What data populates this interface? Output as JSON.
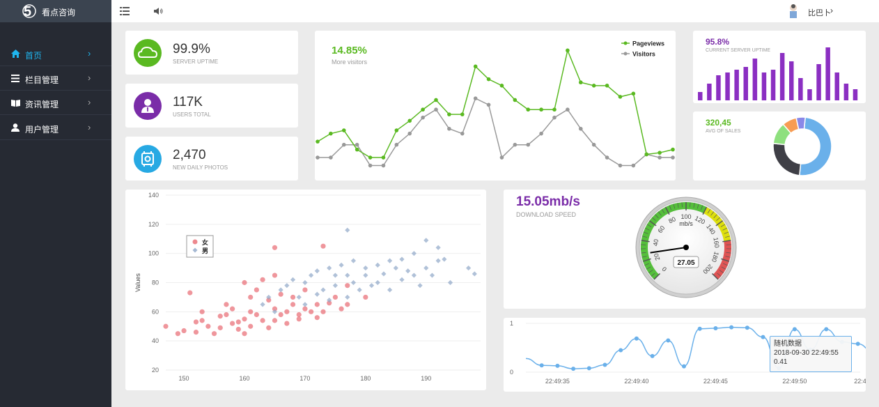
{
  "header": {
    "brand": "看点咨询",
    "user": "比巴卜"
  },
  "colors": {
    "sidebar": "#262a33",
    "accent": "#1fb5ee",
    "green": "#5ab921",
    "purple": "#7a2ca8"
  },
  "sidebar": {
    "items": [
      {
        "label": "首页",
        "icon": "home-icon"
      },
      {
        "label": "栏目管理",
        "icon": "list-icon"
      },
      {
        "label": "资讯管理",
        "icon": "book-icon"
      },
      {
        "label": "用户管理",
        "icon": "user-icon"
      }
    ]
  },
  "stats": [
    {
      "value": "99.9%",
      "label": "SERVER UPTIME",
      "icon": "cloud-icon",
      "color": "#5ab921"
    },
    {
      "value": "117K",
      "label": "USERS TOTAL",
      "icon": "user-suit-icon",
      "color": "#7a2ca8"
    },
    {
      "value": "2,470",
      "label": "NEW DAILY PHOTOS",
      "icon": "camera-icon",
      "color": "#27a9e3"
    }
  ],
  "traffic": {
    "value": "14.85%",
    "label": "More visitors"
  },
  "server": {
    "value": "95.8%",
    "label": "CURRENT SERVER UPTIME"
  },
  "sales": {
    "value": "320,45",
    "label": "AVG OF SALES"
  },
  "download": {
    "value": "15.05mb/s",
    "label": "DOWNLOAD SPEED"
  },
  "tooltip": {
    "title": "随机数据",
    "time": "2018-09-30 22:49:55",
    "value": "0.41"
  },
  "chart_data": [
    {
      "type": "line",
      "series": [
        {
          "name": "Pageviews",
          "color": "#5ab921",
          "values": [
            5,
            10,
            12,
            0,
            -5,
            -5,
            12,
            18,
            25,
            31,
            22,
            22,
            52,
            44,
            40,
            31,
            25,
            25,
            25,
            62,
            42,
            40,
            40,
            33,
            35,
            -3,
            -2,
            0
          ]
        },
        {
          "name": "Visitors",
          "color": "#999999",
          "values": [
            -5,
            -5,
            3,
            3,
            -10,
            -10,
            3,
            10,
            20,
            25,
            13,
            10,
            32,
            28,
            -5,
            3,
            3,
            10,
            20,
            25,
            13,
            3,
            -5,
            -10,
            -10,
            -3,
            -5,
            -5
          ]
        }
      ],
      "ylim": [
        -15,
        70
      ],
      "legend": "top-right"
    },
    {
      "type": "bar",
      "values": [
        3,
        6,
        9,
        10,
        11,
        12,
        15,
        10,
        11,
        17,
        14,
        8,
        4,
        13,
        19,
        10,
        6,
        4
      ],
      "ylim": [
        0,
        20
      ],
      "color": "#8b2fc2"
    },
    {
      "type": "pie",
      "values": [
        50,
        25,
        12,
        8,
        5
      ],
      "colors": [
        "#6ab0ea",
        "#3f3f46",
        "#8ee07e",
        "#f79c54",
        "#8a88e8"
      ]
    },
    {
      "type": "scatter",
      "series": [
        {
          "name": "女",
          "color": "#e86a72",
          "points": [
            [
              147,
              50
            ],
            [
              149,
              45
            ],
            [
              150,
              47
            ],
            [
              151,
              73
            ],
            [
              152,
              53
            ],
            [
              152,
              46
            ],
            [
              153,
              60
            ],
            [
              153,
              54
            ],
            [
              154,
              50
            ],
            [
              155,
              45
            ],
            [
              156,
              57
            ],
            [
              156,
              49
            ],
            [
              157,
              58
            ],
            [
              157,
              65
            ],
            [
              158,
              62
            ],
            [
              158,
              52
            ],
            [
              159,
              53
            ],
            [
              159,
              48
            ],
            [
              160,
              55
            ],
            [
              160,
              80
            ],
            [
              160,
              45
            ],
            [
              161,
              70
            ],
            [
              161,
              60
            ],
            [
              161,
              50
            ],
            [
              162,
              75
            ],
            [
              162,
              58
            ],
            [
              163,
              82
            ],
            [
              163,
              54
            ],
            [
              164,
              68
            ],
            [
              164,
              49
            ],
            [
              165,
              104
            ],
            [
              165,
              85
            ],
            [
              165,
              62
            ],
            [
              165,
              54
            ],
            [
              166,
              72
            ],
            [
              166,
              58
            ],
            [
              167,
              60
            ],
            [
              167,
              52
            ],
            [
              168,
              65
            ],
            [
              168,
              70
            ],
            [
              169,
              58
            ],
            [
              169,
              55
            ],
            [
              170,
              62
            ],
            [
              170,
              75
            ],
            [
              171,
              60
            ],
            [
              172,
              56
            ],
            [
              172,
              65
            ],
            [
              173,
              105
            ],
            [
              173,
              60
            ],
            [
              174,
              66
            ],
            [
              175,
              70
            ],
            [
              176,
              62
            ],
            [
              177,
              78
            ],
            [
              177,
              65
            ],
            [
              180,
              70
            ]
          ]
        },
        {
          "name": "男",
          "color": "#8ea6c8",
          "points": [
            [
              163,
              65
            ],
            [
              164,
              70
            ],
            [
              165,
              60
            ],
            [
              166,
              75
            ],
            [
              167,
              78
            ],
            [
              168,
              82
            ],
            [
              169,
              70
            ],
            [
              170,
              80
            ],
            [
              170,
              65
            ],
            [
              171,
              85
            ],
            [
              172,
              72
            ],
            [
              172,
              88
            ],
            [
              173,
              75
            ],
            [
              174,
              90
            ],
            [
              174,
              68
            ],
            [
              175,
              85
            ],
            [
              175,
              78
            ],
            [
              176,
              92
            ],
            [
              177,
              70
            ],
            [
              177,
              85
            ],
            [
              177,
              116
            ],
            [
              178,
              80
            ],
            [
              178,
              95
            ],
            [
              179,
              75
            ],
            [
              180,
              85
            ],
            [
              180,
              90
            ],
            [
              181,
              78
            ],
            [
              182,
              92
            ],
            [
              182,
              80
            ],
            [
              183,
              86
            ],
            [
              184,
              95
            ],
            [
              184,
              75
            ],
            [
              185,
              90
            ],
            [
              186,
              82
            ],
            [
              186,
              96
            ],
            [
              187,
              88
            ],
            [
              188,
              85
            ],
            [
              188,
              100
            ],
            [
              189,
              78
            ],
            [
              190,
              90
            ],
            [
              190,
              109
            ],
            [
              191,
              85
            ],
            [
              192,
              104
            ],
            [
              192,
              95
            ],
            [
              193,
              96
            ],
            [
              194,
              80
            ],
            [
              197,
              90
            ],
            [
              198,
              86
            ]
          ]
        }
      ],
      "xlim": [
        147,
        199
      ],
      "ylim": [
        20,
        140
      ],
      "xticks": [
        150,
        160,
        170,
        180,
        190
      ],
      "yticks": [
        20,
        40,
        60,
        80,
        100,
        120,
        140
      ],
      "ylabel": "Values",
      "legend": "top-left"
    },
    {
      "type": "gauge",
      "value": 27.05,
      "min": 0,
      "max": 200,
      "unit": "mb/s",
      "ticks": [
        0,
        20,
        40,
        60,
        80,
        100,
        120,
        140,
        160,
        180,
        200
      ]
    },
    {
      "type": "line",
      "x": [
        "22:49:33",
        "22:49:34",
        "22:49:35",
        "22:49:36",
        "22:49:37",
        "22:49:38",
        "22:49:39",
        "22:49:40",
        "22:49:41",
        "22:49:42",
        "22:49:43",
        "22:49:44",
        "22:49:45",
        "22:49:46",
        "22:49:47",
        "22:49:48",
        "22:49:49",
        "22:49:50",
        "22:49:51",
        "22:49:52",
        "22:49:53",
        "22:49:54",
        "22:49:55"
      ],
      "values": [
        0.28,
        0.14,
        0.13,
        0.07,
        0.08,
        0.15,
        0.45,
        0.69,
        0.33,
        0.65,
        0.12,
        0.89,
        0.9,
        0.92,
        0.91,
        0.72,
        0.08,
        0.88,
        0.46,
        0.88,
        0.62,
        0.58,
        0.41
      ],
      "xticks": [
        "22:49:35",
        "22:49:40",
        "22:49:45",
        "22:49:50",
        "22:4"
      ],
      "ylim": [
        0,
        1
      ],
      "yticks": [
        0,
        1
      ],
      "color": "#6ab0ea"
    }
  ]
}
